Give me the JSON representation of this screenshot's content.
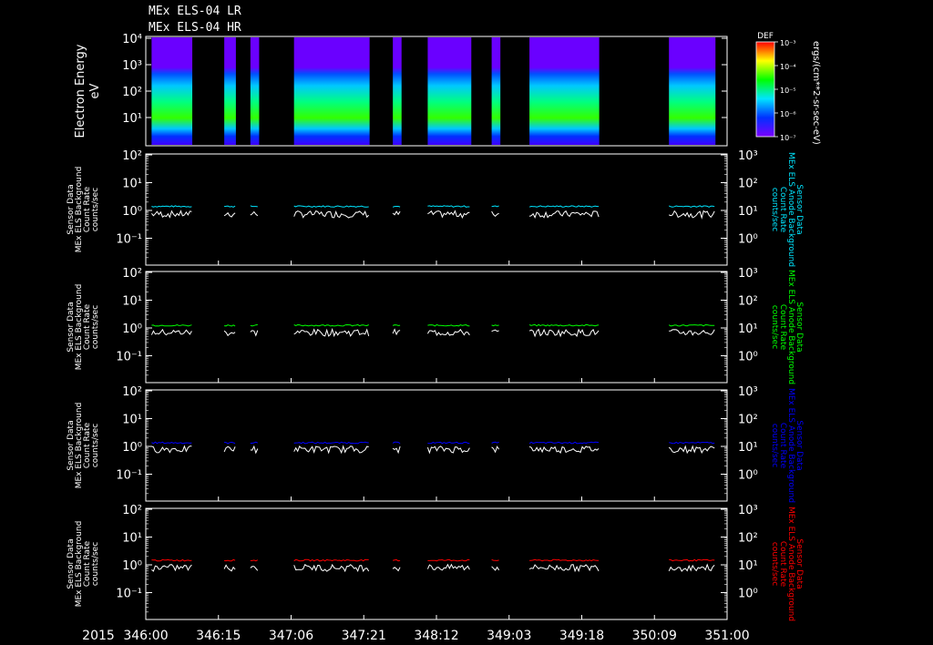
{
  "header": {
    "title_lr": "MEx ELS-04 LR",
    "title_hr": "MEx ELS-04 HR"
  },
  "x_axis": {
    "year_label": "2015",
    "tick_labels": [
      "346:00",
      "346:15",
      "347:06",
      "347:21",
      "348:12",
      "349:03",
      "349:18",
      "350:09",
      "351:00"
    ]
  },
  "spectrogram": {
    "ylabel_line1": "Electron Energy",
    "ylabel_line2": "eV",
    "y_tick_labels": [
      "10⁴",
      "10³",
      "10²",
      "10¹"
    ],
    "colorbar_title": "DEF",
    "colorbar_tick_labels": [
      "10⁻³",
      "10⁻⁴",
      "10⁻⁵",
      "10⁻⁶",
      "10⁻⁷"
    ],
    "colorbar_units": "ergs/(cm**2-sr-sec-eV)"
  },
  "chart_data": [
    {
      "type": "heatmap",
      "ylabel": "Electron Energy eV",
      "yscale": "log",
      "ylim": [
        2,
        10000
      ],
      "xlim": [
        0,
        1
      ],
      "data_intervals": [
        [
          0.01,
          0.08
        ],
        [
          0.135,
          0.155
        ],
        [
          0.18,
          0.195
        ],
        [
          0.255,
          0.385
        ],
        [
          0.425,
          0.44
        ],
        [
          0.485,
          0.56
        ],
        [
          0.595,
          0.61
        ],
        [
          0.66,
          0.78
        ],
        [
          0.9,
          0.98
        ]
      ],
      "color_scale": [
        "#6a00ff",
        "#0040ff",
        "#00ffff",
        "#00ff00",
        "#ffff00",
        "#ff0000"
      ],
      "colorbar_label": "DEF ergs/(cm**2-sr-sec-eV)"
    },
    {
      "type": "line",
      "left_ylabel": "Sensor Data MEx ELS Background Count Rate counts/sec",
      "right_ylabel": "MEx ELS Anode Background Count Rate counts/sec",
      "yscale": "log",
      "ylim_left": [
        0.01,
        100
      ],
      "ylim_right": [
        0.1,
        1000
      ],
      "series": [
        {
          "color": "#00e5ff",
          "level": 1.3
        },
        {
          "color": "#ffffff",
          "level": 0.7
        }
      ]
    },
    {
      "type": "line",
      "left_ylabel": "Sensor Data MEx ELS Background Count Rate counts/sec",
      "right_ylabel": "MEx ELS Anode Background Count Rate counts/sec",
      "yscale": "log",
      "ylim_left": [
        0.01,
        100
      ],
      "ylim_right": [
        0.1,
        1000
      ],
      "series": [
        {
          "color": "#00ff00",
          "level": 1.15
        },
        {
          "color": "#ffffff",
          "level": 0.65
        }
      ]
    },
    {
      "type": "line",
      "left_ylabel": "Sensor Data MEx ELS Background Count Rate counts/sec",
      "right_ylabel": "MEx ELS Anode Background Count Rate counts/sec",
      "yscale": "log",
      "ylim_left": [
        0.01,
        100
      ],
      "ylim_right": [
        0.1,
        1000
      ],
      "series": [
        {
          "color": "#0000ff",
          "level": 1.25
        },
        {
          "color": "#ffffff",
          "level": 0.75
        }
      ]
    },
    {
      "type": "line",
      "left_ylabel": "Sensor Data MEx ELS Background Count Rate counts/sec",
      "right_ylabel": "MEx ELS Anode Background Count Rate counts/sec",
      "yscale": "log",
      "ylim_left": [
        0.01,
        100
      ],
      "ylim_right": [
        0.1,
        1000
      ],
      "series": [
        {
          "color": "#ff0000",
          "level": 1.35
        },
        {
          "color": "#ffffff",
          "level": 0.75
        }
      ]
    }
  ],
  "line_panels": [
    {
      "color": "#00e5ff",
      "left_label": [
        "Sensor Data",
        "MEx ELS Background",
        "Count Rate",
        "counts/sec"
      ],
      "right_label": [
        "Sensor Data",
        "MEx ELS Anode Background",
        "Count Rate",
        "counts/sec"
      ],
      "left_ticks": [
        "10²",
        "10¹",
        "10⁰",
        "10⁻¹"
      ],
      "right_ticks": [
        "10³",
        "10²",
        "10¹",
        "10⁰"
      ]
    },
    {
      "color": "#00ff00",
      "left_label": [
        "Sensor Data",
        "MEx ELS Background",
        "Count Rate",
        "counts/sec"
      ],
      "right_label": [
        "Sensor Data",
        "MEx ELS Anode Background",
        "Count Rate",
        "counts/sec"
      ],
      "left_ticks": [
        "10²",
        "10¹",
        "10⁰",
        "10⁻¹"
      ],
      "right_ticks": [
        "10³",
        "10²",
        "10¹",
        "10⁰"
      ]
    },
    {
      "color": "#0000ff",
      "left_label": [
        "Sensor Data",
        "MEx ELS Background",
        "Count Rate",
        "counts/sec"
      ],
      "right_label": [
        "Sensor Data",
        "MEx ELS Anode Background",
        "Count Rate",
        "counts/sec"
      ],
      "left_ticks": [
        "10²",
        "10¹",
        "10⁰",
        "10⁻¹"
      ],
      "right_ticks": [
        "10³",
        "10²",
        "10¹",
        "10⁰"
      ]
    },
    {
      "color": "#ff0000",
      "left_label": [
        "Sensor Data",
        "MEx ELS Background",
        "Count Rate",
        "counts/sec"
      ],
      "right_label": [
        "Sensor Data",
        "MEx ELS Anode Background",
        "Count Rate",
        "counts/sec"
      ],
      "left_ticks": [
        "10²",
        "10¹",
        "10⁰",
        "10⁻¹"
      ],
      "right_ticks": [
        "10³",
        "10²",
        "10¹",
        "10⁰"
      ]
    }
  ]
}
